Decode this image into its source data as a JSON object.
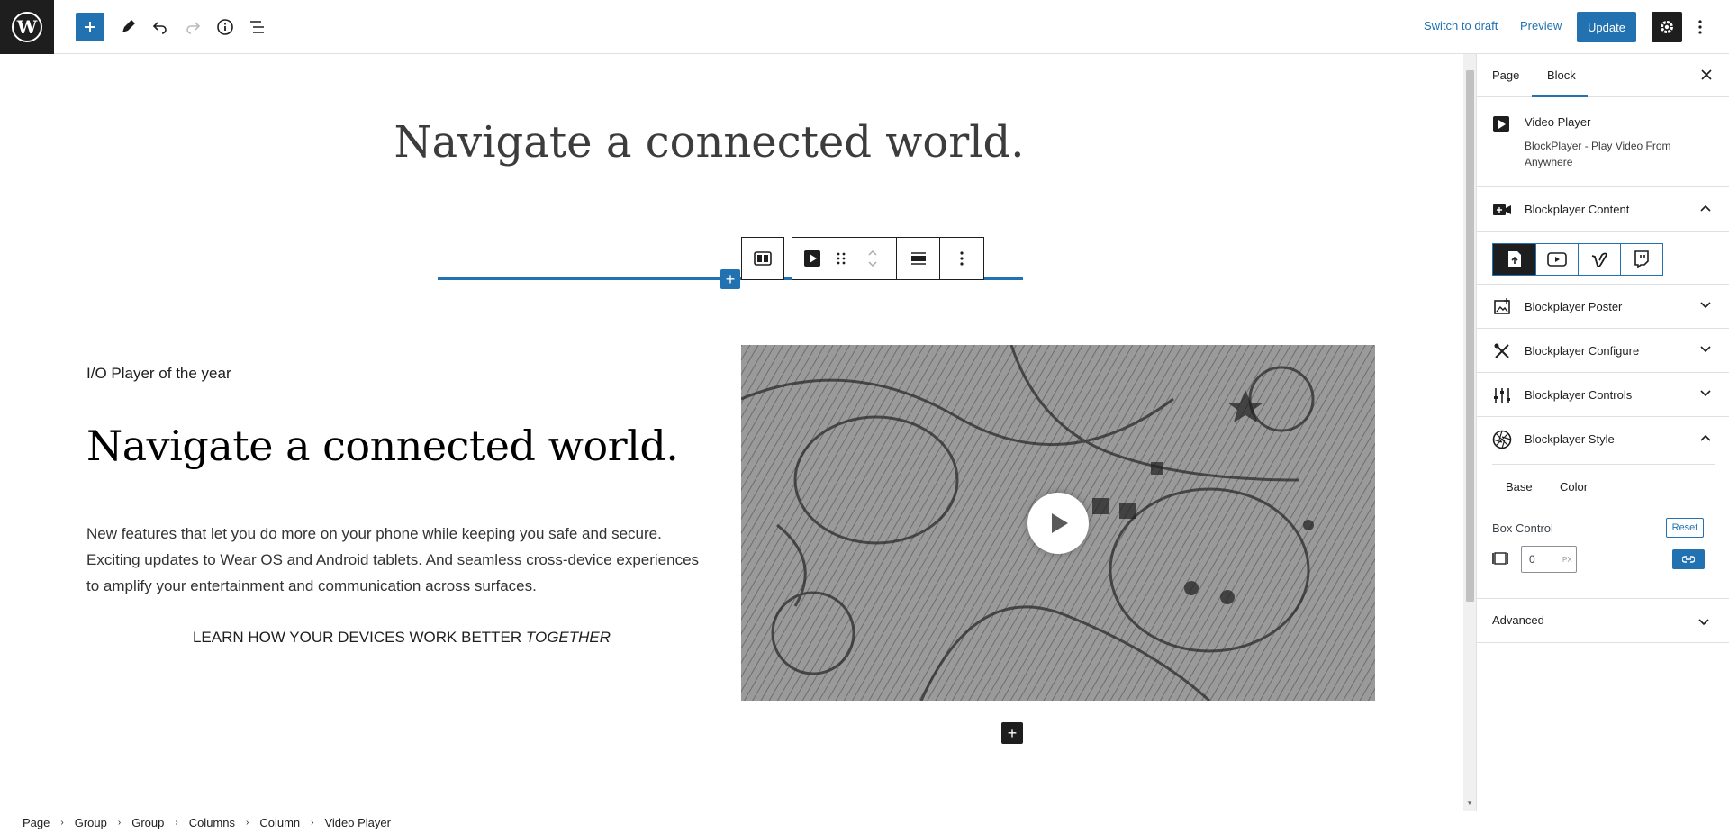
{
  "toolbar": {
    "switch_to_draft": "Switch to draft",
    "preview": "Preview",
    "update": "Update"
  },
  "canvas": {
    "hero_title": "Navigate a connected world.",
    "eyebrow": "I/O Player of the year",
    "heading": "Navigate a connected world.",
    "paragraph": "New features that let you do more on your phone while keeping you safe and secure. Exciting updates to Wear OS and Android tablets. And seamless cross-device experiences to amplify your entertainment and communication across surfaces.",
    "cta_main": "LEARN HOW YOUR DEVICES WORK BETTER ",
    "cta_em": "TOGETHER"
  },
  "sidebar": {
    "tabs": [
      "Page",
      "Block"
    ],
    "active_tab": "Block",
    "block_name": "Video Player",
    "block_desc": "BlockPlayer - Play Video From Anywhere",
    "panels": [
      {
        "title": "Blockplayer Content",
        "icon": "video-camera-icon",
        "expanded": true
      },
      {
        "title": "Blockplayer Poster",
        "icon": "image-icon",
        "expanded": false
      },
      {
        "title": "Blockplayer Configure",
        "icon": "tools-icon",
        "expanded": false
      },
      {
        "title": "Blockplayer Controls",
        "icon": "sliders-icon",
        "expanded": false
      },
      {
        "title": "Blockplayer Style",
        "icon": "aperture-icon",
        "expanded": true
      }
    ],
    "sources": [
      "upload-icon",
      "youtube-icon",
      "vimeo-icon",
      "twitch-icon"
    ],
    "style_tabs": [
      "Base",
      "Color"
    ],
    "box_control_label": "Box Control",
    "reset": "Reset",
    "box_value": "0",
    "box_unit": "PX",
    "advanced": "Advanced"
  },
  "breadcrumbs": [
    "Page",
    "Group",
    "Group",
    "Columns",
    "Column",
    "Video Player"
  ],
  "colors": {
    "accent": "#2271b1",
    "dark": "#1e1e1e"
  }
}
